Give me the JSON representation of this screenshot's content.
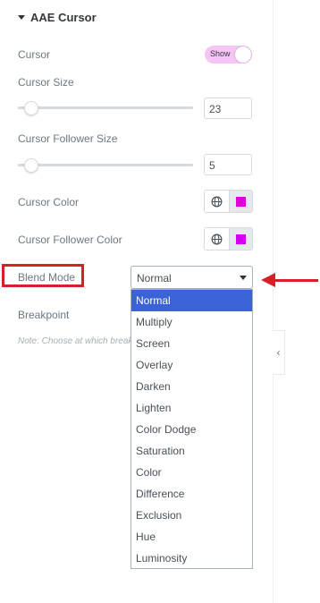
{
  "section": {
    "title": "AAE Cursor"
  },
  "controls": {
    "cursor_label": "Cursor",
    "cursor_toggle_text": "Show",
    "cursor_size_label": "Cursor Size",
    "cursor_size_value": "23",
    "cursor_size_fraction": 0.04,
    "follower_size_label": "Cursor Follower Size",
    "follower_size_value": "5",
    "follower_size_fraction": 0.04,
    "cursor_color_label": "Cursor Color",
    "cursor_color": "#e100d7",
    "follower_color_label": "Cursor Follower Color",
    "follower_color": "#d400f0",
    "blend_mode_label": "Blend Mode",
    "blend_mode_value": "Normal",
    "breakpoint_label": "Breakpoint",
    "note": "Note: Choose at which breakpoint"
  },
  "dropdown": {
    "options": [
      "Normal",
      "Multiply",
      "Screen",
      "Overlay",
      "Darken",
      "Lighten",
      "Color Dodge",
      "Saturation",
      "Color",
      "Difference",
      "Exclusion",
      "Hue",
      "Luminosity"
    ],
    "selected_index": 0
  },
  "icons": {
    "section_caret": "caret-down-icon",
    "globe": "globe-icon",
    "collapse": "chevron-left-icon",
    "annotation_arrow": "arrow-left-icon"
  },
  "colors": {
    "toggle_bg": "#f7c4f6",
    "highlight": "#d62027",
    "selected_option_bg": "#3b62d6"
  },
  "side_tab_glyph": "‹"
}
